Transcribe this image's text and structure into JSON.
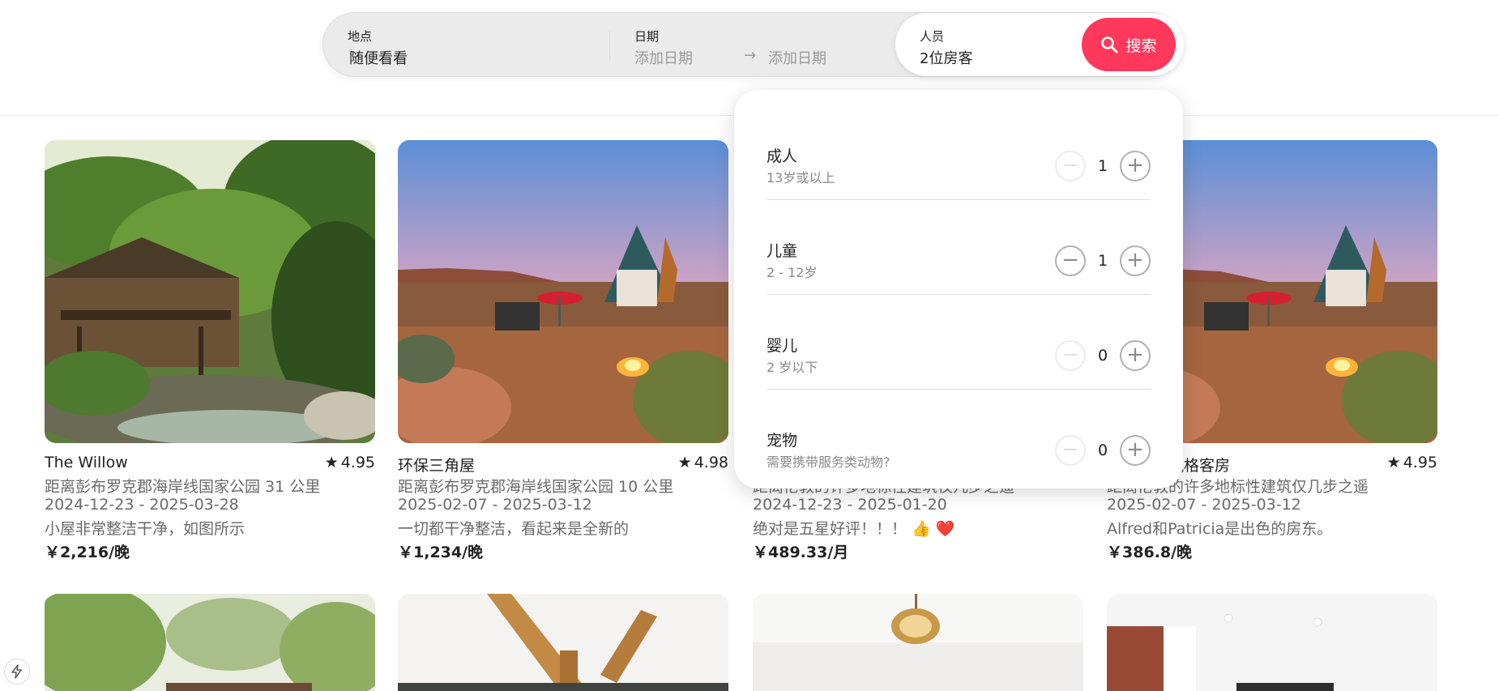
{
  "search": {
    "location_label": "地点",
    "location_value": "随便看看",
    "date_label": "日期",
    "checkin_placeholder": "添加日期",
    "checkout_placeholder": "添加日期",
    "date_arrow": "→",
    "guests_label": "人员",
    "guests_value": "2位房客",
    "search_button_label": "搜索",
    "accent_color": "#ff385c"
  },
  "guests_panel": {
    "rows": [
      {
        "title": "成人",
        "subtitle": "13岁或以上",
        "count": "1",
        "minus_enabled": false
      },
      {
        "title": "儿童",
        "subtitle": "2 - 12岁",
        "count": "1",
        "minus_enabled": true
      },
      {
        "title": "婴儿",
        "subtitle": "2 岁以下",
        "count": "0",
        "minus_enabled": false
      },
      {
        "title": "宠物",
        "subtitle": "需要携带服务类动物?",
        "count": "0",
        "minus_enabled": false
      }
    ],
    "minus_symbol": "−",
    "plus_symbol": "+"
  },
  "listings": [
    {
      "title": "The Willow",
      "rating": "4.95",
      "distance": "距离彭布罗克郡海岸线国家公园 31 公里",
      "dates": "2024-12-23 - 2025-03-28",
      "review": "小屋非常整洁干净，如图所示",
      "price": "￥2,216/晚",
      "photo": "forest-cabin"
    },
    {
      "title": "环保三角屋",
      "rating": "4.98",
      "distance": "距离彭布罗克郡海岸线国家公园 10 公里",
      "dates": "2025-02-07 - 2025-03-12",
      "review": "一切都干净整洁，看起来是全新的",
      "price": "￥1,234/晚",
      "photo": "desert-aframe"
    },
    {
      "title": "",
      "rating": "",
      "distance": "距离伦敦的许多地标性建筑仅几步之遥",
      "dates": "2024-12-23 - 2025-01-20",
      "review": "绝对是五星好评！！！ 👍 ❤️",
      "price": "￥489.33/月",
      "photo": "hidden"
    },
    {
      "title": "宽敞现代风格客房",
      "rating": "4.95",
      "distance": "距离伦敦的许多地标性建筑仅几步之遥",
      "dates": "2025-02-07 - 2025-03-12",
      "review": "Alfred和Patricia是出色的房东。",
      "price": "￥386.8/晚",
      "photo": "desert-aframe"
    }
  ],
  "row2_photos": [
    "garden-house",
    "wood-beam-interior",
    "white-room-chandelier",
    "brick-wall-room"
  ],
  "star_symbol": "★",
  "corner_badge_icon": "lightning-icon"
}
